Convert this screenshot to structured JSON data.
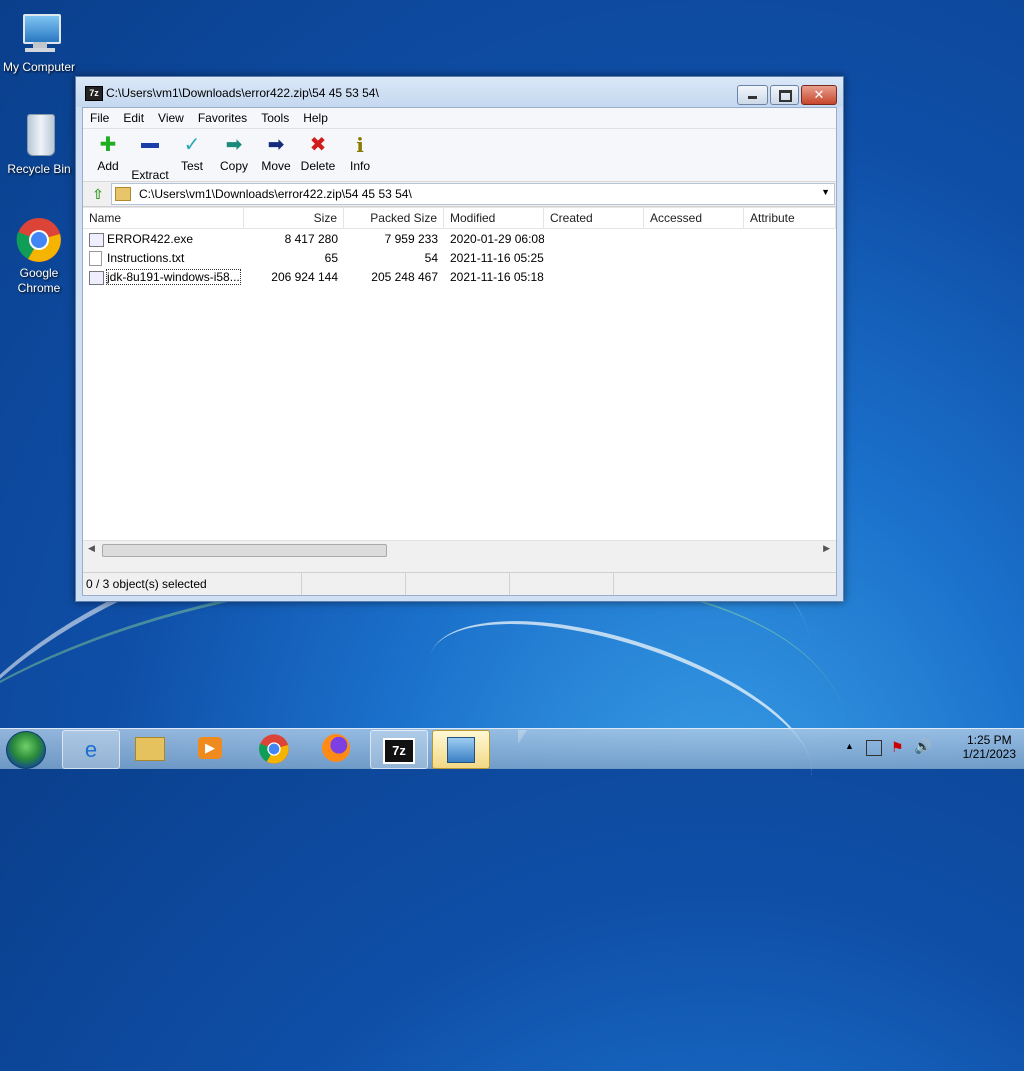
{
  "desktop": {
    "icons": [
      {
        "label": "My Computer"
      },
      {
        "label": "Recycle Bin"
      },
      {
        "label": "Google Chrome"
      }
    ]
  },
  "window": {
    "title": "C:\\Users\\vm1\\Downloads\\error422.zip\\54 45 53 54\\",
    "app_icon": "7z",
    "menu": [
      "File",
      "Edit",
      "View",
      "Favorites",
      "Tools",
      "Help"
    ],
    "toolbar": [
      {
        "label": "Add",
        "icon": "plus-icon"
      },
      {
        "label": "Extract",
        "icon": "minus-icon"
      },
      {
        "label": "Test",
        "icon": "check-icon"
      },
      {
        "label": "Copy",
        "icon": "copy-arrow-icon"
      },
      {
        "label": "Move",
        "icon": "move-arrow-icon"
      },
      {
        "label": "Delete",
        "icon": "delete-x-icon"
      },
      {
        "label": "Info",
        "icon": "info-icon"
      }
    ],
    "address": "C:\\Users\\vm1\\Downloads\\error422.zip\\54 45 53 54\\",
    "columns": [
      "Name",
      "Size",
      "Packed Size",
      "Modified",
      "Created",
      "Accessed",
      "Attribute"
    ],
    "files": [
      {
        "name": "ERROR422.exe",
        "size": "8 417 280",
        "packed": "7 959 233",
        "modified": "2020-01-29 06:08"
      },
      {
        "name": "Instructions.txt",
        "size": "65",
        "packed": "54",
        "modified": "2021-11-16 05:25"
      },
      {
        "name": "jdk-8u191-windows-i58...",
        "size": "206 924 144",
        "packed": "205 248 467",
        "modified": "2021-11-16 05:18"
      }
    ],
    "status": "0 / 3 object(s) selected"
  },
  "taskbar": {
    "time": "1:25 PM",
    "date": "1/21/2023",
    "active_label": "7z"
  }
}
